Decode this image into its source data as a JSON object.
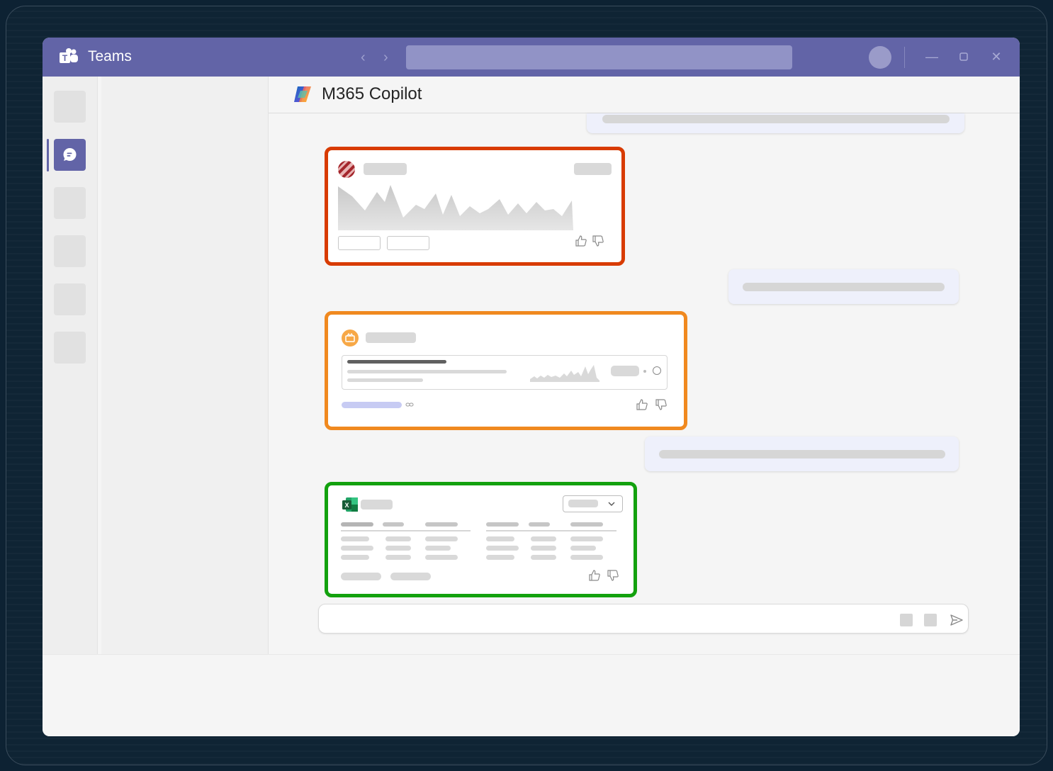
{
  "app": {
    "title": "Teams"
  },
  "titlebar": {
    "search_placeholder": "",
    "back_icon": "chevron-left",
    "forward_icon": "chevron-right"
  },
  "rail": {
    "items": [
      "placeholder",
      "chat",
      "placeholder",
      "placeholder",
      "placeholder",
      "placeholder"
    ],
    "active": "chat"
  },
  "chat": {
    "title": "M365 Copilot"
  },
  "cards": [
    {
      "name": "red-chart-card",
      "border_color": "#d83b01",
      "icon": "striped-circle-icon"
    },
    {
      "name": "orange-list-card",
      "border_color": "#f0891f",
      "icon": "orange-circle-icon"
    },
    {
      "name": "excel-table-card",
      "border_color": "#13a10e",
      "icon": "excel-icon"
    }
  ],
  "compose": {
    "placeholder": ""
  },
  "colors": {
    "teams_purple": "#6264a7",
    "background": "#0d2233"
  }
}
